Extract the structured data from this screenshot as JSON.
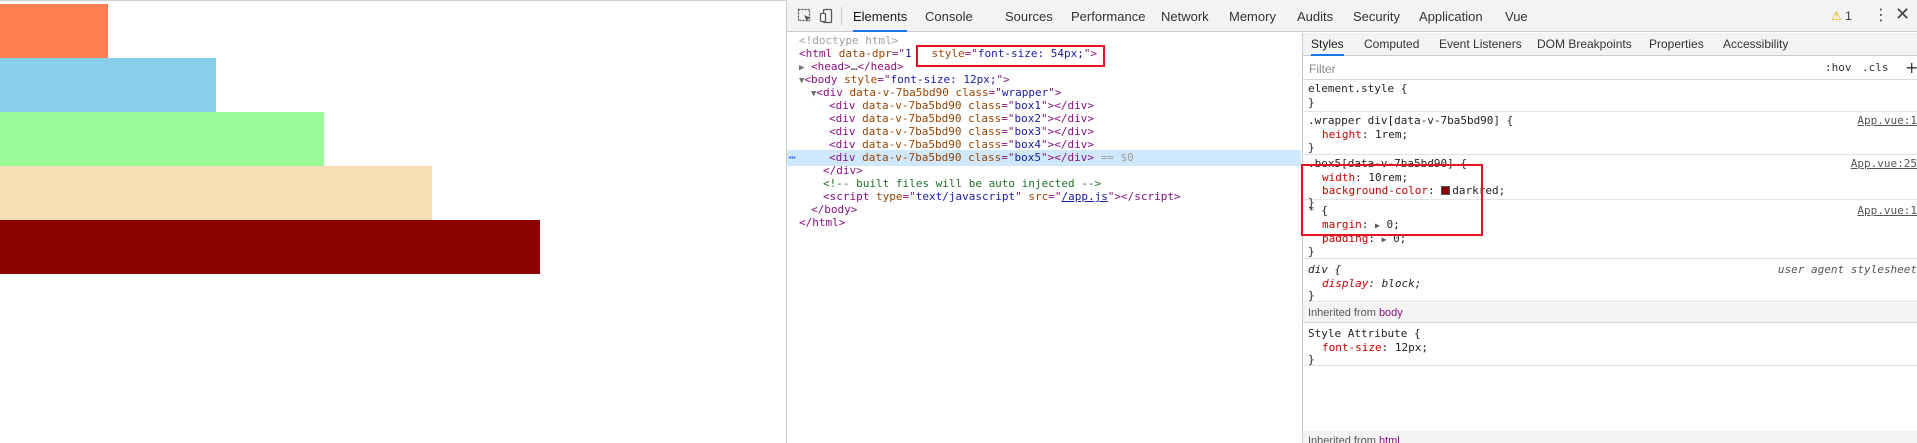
{
  "page": {
    "boxes": [
      {
        "name": "box1",
        "color": "#ff7f50"
      },
      {
        "name": "box2",
        "color": "#87ceeb"
      },
      {
        "name": "box3",
        "color": "#98fb98"
      },
      {
        "name": "box4",
        "color": "#f5deb3"
      },
      {
        "name": "box5",
        "color": "#8b0000"
      }
    ]
  },
  "devtools": {
    "tabs": [
      "Elements",
      "Console",
      "Sources",
      "Performance",
      "Network",
      "Memory",
      "Audits",
      "Security",
      "Application",
      "Vue"
    ],
    "active_tab": "Elements",
    "warning_count": "1",
    "dom": {
      "doctype": "<!doctype html>",
      "html_open_tag": "html",
      "html_attr_name": "data-dpr",
      "html_attr_value_partial": "1",
      "html_style_attr": "style",
      "html_style_value": "font-size: 54px;",
      "head": "head",
      "head_ellipsis": "…",
      "body_tag": "body",
      "body_style_value": "font-size: 12px;",
      "wrapper_attr": "data-v-7ba5bd90",
      "wrapper_class": "wrapper",
      "children": [
        {
          "attr": "data-v-7ba5bd90",
          "class": "box1"
        },
        {
          "attr": "data-v-7ba5bd90",
          "class": "box2"
        },
        {
          "attr": "data-v-7ba5bd90",
          "class": "box3"
        },
        {
          "attr": "data-v-7ba5bd90",
          "class": "box4"
        },
        {
          "attr": "data-v-7ba5bd90",
          "class": "box5"
        }
      ],
      "selected_suffix": "== $0",
      "comment": "<!-- built files will be auto injected -->",
      "script_type": "text/javascript",
      "script_src": "/app.js"
    },
    "styles_tabs": [
      "Styles",
      "Computed",
      "Event Listeners",
      "DOM Breakpoints",
      "Properties",
      "Accessibility"
    ],
    "filter_placeholder": "Filter",
    "filter_buttons": [
      ":hov",
      ".cls"
    ],
    "rules": {
      "element_style": "element.style {",
      "wrapper_selector": ".wrapper div[data-v-7ba5bd90] {",
      "wrapper_source": "App.vue:1",
      "wrapper_prop": "height",
      "wrapper_val": "1rem;",
      "box5_selector": ".box5[data-v-7ba5bd90] {",
      "box5_source": "App.vue:25",
      "box5_width_prop": "width",
      "box5_width_val": "10rem;",
      "box5_bg_prop": "background-color",
      "box5_bg_val": "darkred;",
      "box5_bg_color": "#8b0000",
      "universal_selector": "* {",
      "universal_source": "App.vue:1",
      "margin_prop": "margin",
      "margin_val": "0;",
      "padding_prop": "padding",
      "padding_val": "0;",
      "div_selector": "div {",
      "div_source": "user agent stylesheet",
      "display_prop": "display",
      "display_val": "block;",
      "inherited_from_body": "Inherited from",
      "inherited_body_tag": "body",
      "style_attribute": "Style Attribute {",
      "fontsize_prop": "font-size",
      "fontsize_val": "12px;",
      "inherited_from_html": "Inherited from",
      "inherited_html_tag": "html",
      "close_brace": "}"
    }
  }
}
